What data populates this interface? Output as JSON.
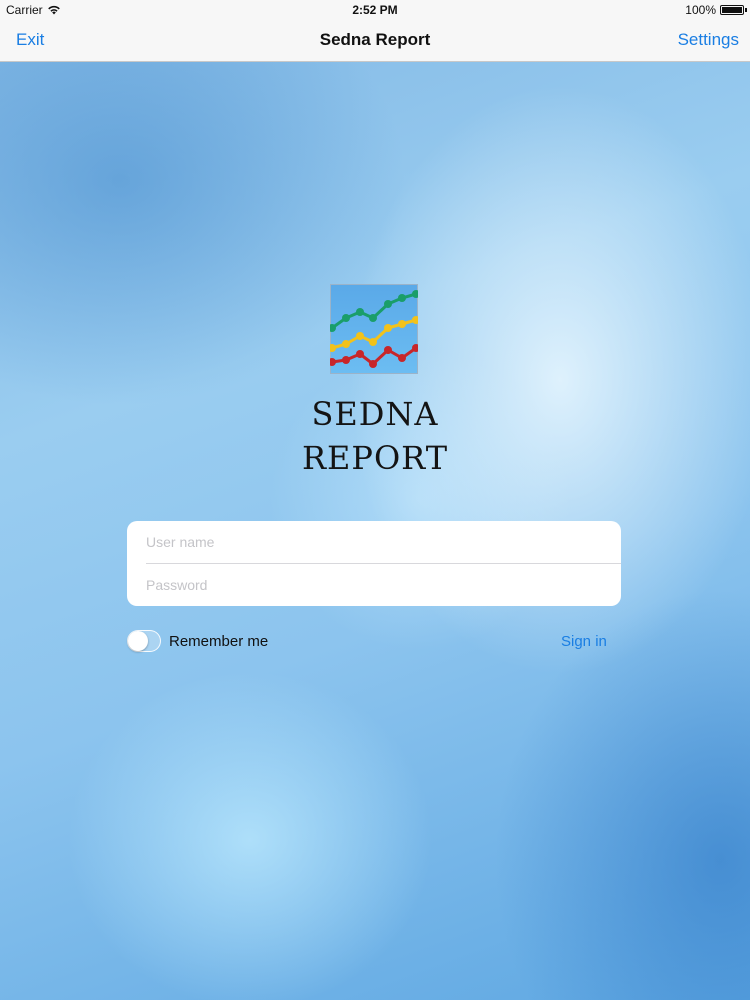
{
  "status_bar": {
    "carrier": "Carrier",
    "time": "2:52 PM",
    "battery": "100%",
    "icons": [
      "wifi-icon",
      "battery-icon"
    ]
  },
  "nav_bar": {
    "exit_label": "Exit",
    "title": "Sedna Report",
    "settings_label": "Settings"
  },
  "logo": {
    "icon": "line-chart-logo",
    "line1": "SEDNA",
    "line2": "REPORT"
  },
  "login_form": {
    "username_placeholder": "User name",
    "username_value": "",
    "password_placeholder": "Password",
    "password_value": ""
  },
  "options": {
    "remember_label": "Remember me",
    "remember_on": false,
    "signin_label": "Sign in"
  },
  "colors": {
    "accent": "#1a7ee3",
    "logo_green": "#1a9e6a",
    "logo_yellow": "#f2c21b",
    "logo_red": "#c8262a",
    "logo_bg": "#63b3ee"
  }
}
